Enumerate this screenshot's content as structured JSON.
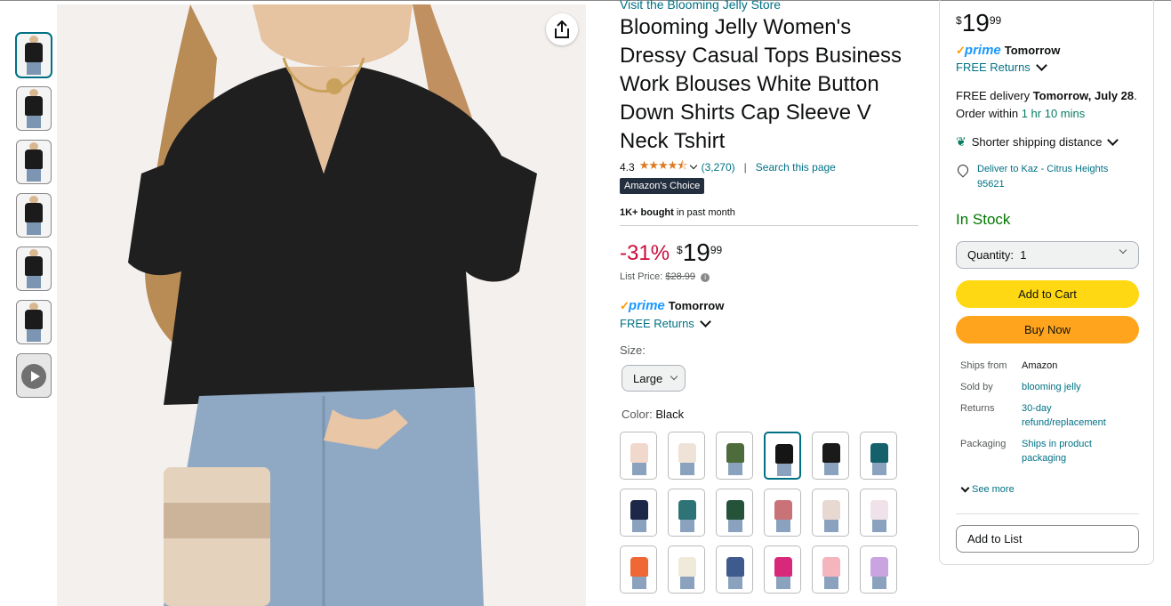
{
  "store_link": "Visit the Blooming Jelly Store",
  "title": "Blooming Jelly Women's Dressy Casual Tops Business Work Blouses White Button Down Shirts Cap Sleeve V Neck Tshirt",
  "rating": {
    "value": "4.3",
    "stars_fraction": 0.86,
    "count": "(3,270)",
    "separator": "|",
    "search_link": "Search this page"
  },
  "badge": "Amazon's Choice",
  "bought": {
    "bold": "1K+ bought",
    "rest": " in past month"
  },
  "price": {
    "discount": "-31%",
    "currency": "$",
    "whole": "19",
    "fraction": "99"
  },
  "list_price": {
    "label": "List Price:",
    "value": "$28.99",
    "info_icon": "i"
  },
  "prime": {
    "check": "✓",
    "logo": "prime",
    "day": "Tomorrow"
  },
  "returns": "FREE Returns",
  "size": {
    "label": "Size:",
    "selected": "Large"
  },
  "color": {
    "label": "Color:",
    "selected": "Black"
  },
  "swatches": [
    {
      "shirt": "#f1d8cc"
    },
    {
      "shirt": "#eee3d6"
    },
    {
      "shirt": "#4e6b3c"
    },
    {
      "shirt": "#151515",
      "selected": true
    },
    {
      "shirt": "#1a1a1a"
    },
    {
      "shirt": "#15616b"
    },
    {
      "shirt": "#1d2748"
    },
    {
      "shirt": "#2e7476"
    },
    {
      "shirt": "#25533a"
    },
    {
      "shirt": "#c97378"
    },
    {
      "shirt": "#e8d8d2"
    },
    {
      "shirt": "#efe2e8"
    },
    {
      "shirt": "#ee6735"
    },
    {
      "shirt": "#efeada"
    },
    {
      "shirt": "#3f5a8c"
    },
    {
      "shirt": "#d8287a"
    },
    {
      "shirt": "#f4b5bd"
    },
    {
      "shirt": "#c9a4e0"
    }
  ],
  "buybox": {
    "currency": "$",
    "whole": "19",
    "fraction": "99",
    "prime_day": "Tomorrow",
    "returns": "FREE Returns",
    "delivery_prefix": "FREE delivery ",
    "delivery_date": "Tomorrow, July 28",
    "order_within_prefix": ". Order within ",
    "order_within_time": "1 hr 10 mins",
    "shorter": "Shorter shipping distance",
    "deliver_to": "Deliver to Kaz - Citrus Heights 95621",
    "stock": "In Stock",
    "quantity_label": "Quantity:",
    "quantity_value": "1",
    "add_to_cart": "Add to Cart",
    "buy_now": "Buy Now",
    "info": [
      {
        "key": "Ships from",
        "value": "Amazon"
      },
      {
        "key": "Sold by",
        "value": "blooming jelly"
      },
      {
        "key": "Returns",
        "value": "30-day refund/replacement"
      },
      {
        "key": "Packaging",
        "value": "Ships in product packaging"
      }
    ],
    "see_more": "See more",
    "add_to_list": "Add to List"
  },
  "colors": {
    "link": "#007185",
    "discount": "#cc0c39",
    "cart": "#ffd814",
    "buy": "#ffa41c",
    "stock": "#007600",
    "prime_blue": "#1a98ff"
  }
}
